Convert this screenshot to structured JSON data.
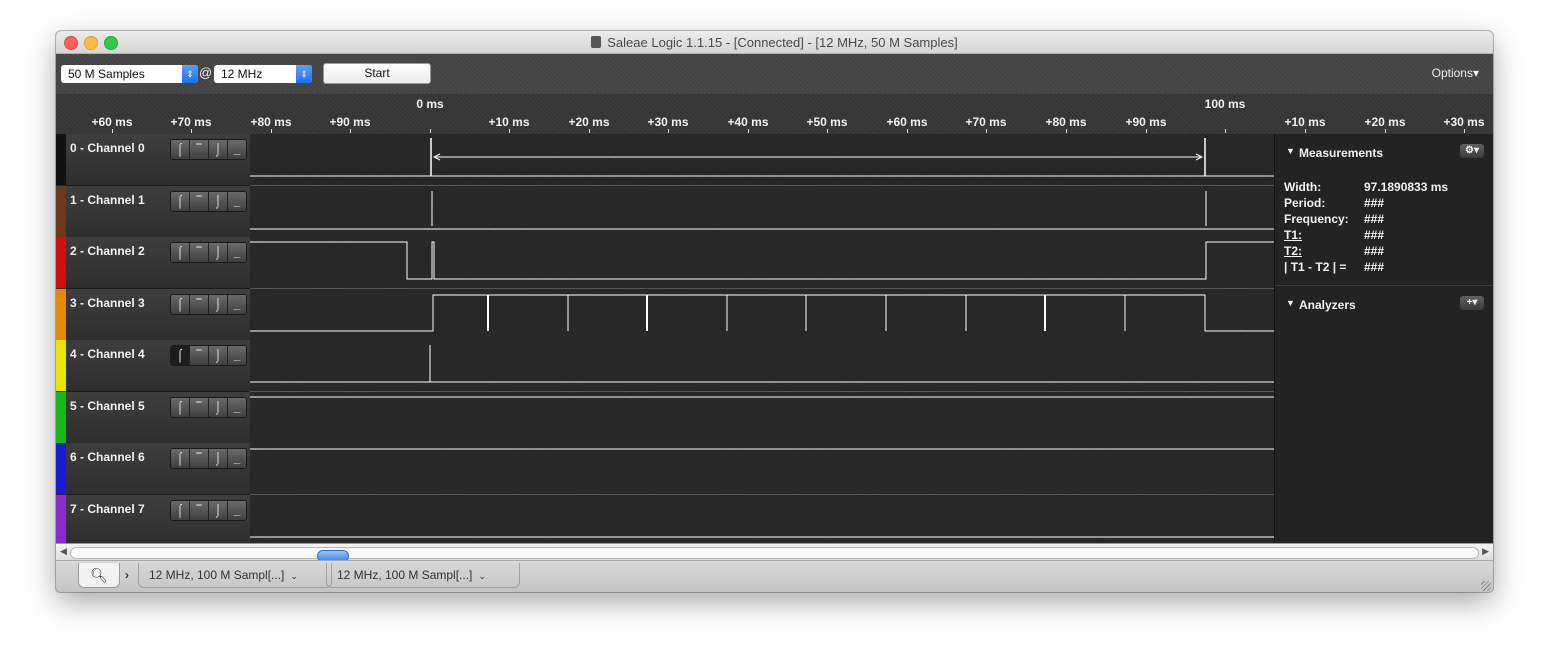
{
  "window": {
    "title": "Saleae Logic 1.1.15 - [Connected] - [12 MHz, 50 M Samples]"
  },
  "toolbar": {
    "samples_value": "50 M Samples",
    "at_symbol": "@",
    "rate_value": "12 MHz",
    "start_label": "Start",
    "options_label": "Options▾"
  },
  "ruler": {
    "major_labels": [
      "0 ms",
      "100 ms"
    ],
    "ticks": [
      "+60 ms",
      "+70 ms",
      "+80 ms",
      "+90 ms",
      "+10 ms",
      "+20 ms",
      "+30 ms",
      "+40 ms",
      "+50 ms",
      "+60 ms",
      "+70 ms",
      "+80 ms",
      "+90 ms",
      "+10 ms",
      "+20 ms",
      "+30 ms"
    ]
  },
  "channels": [
    {
      "label": "0 - Channel 0",
      "color": "#111111"
    },
    {
      "label": "1 - Channel 1",
      "color": "#6b3a1e"
    },
    {
      "label": "2 - Channel 2",
      "color": "#d01010"
    },
    {
      "label": "3 - Channel 3",
      "color": "#e58a00"
    },
    {
      "label": "4 - Channel 4",
      "color": "#e6e600"
    },
    {
      "label": "5 - Channel 5",
      "color": "#17b817"
    },
    {
      "label": "6 - Channel 6",
      "color": "#1a1ad6"
    },
    {
      "label": "7 - Channel 7",
      "color": "#8a2ad0"
    }
  ],
  "trigger_icons": [
    "rising-edge-icon",
    "high-level-icon",
    "falling-edge-icon",
    "low-level-icon"
  ],
  "measurements": {
    "title": "Measurements",
    "rows": [
      {
        "key": "Width:",
        "value": "97.1890833 ms"
      },
      {
        "key": "Period:",
        "value": "###"
      },
      {
        "key": "Frequency:",
        "value": "###"
      },
      {
        "key": "T1:",
        "value": "###"
      },
      {
        "key": "T2:",
        "value": "###"
      },
      {
        "key": "| T1 - T2 | =",
        "value": "###"
      }
    ]
  },
  "analyzers": {
    "title": "Analyzers"
  },
  "tabs": {
    "capture1": "12 MHz, 100 M Sampl[...]",
    "capture2": "12 MHz, 100 M Sampl[...]"
  }
}
